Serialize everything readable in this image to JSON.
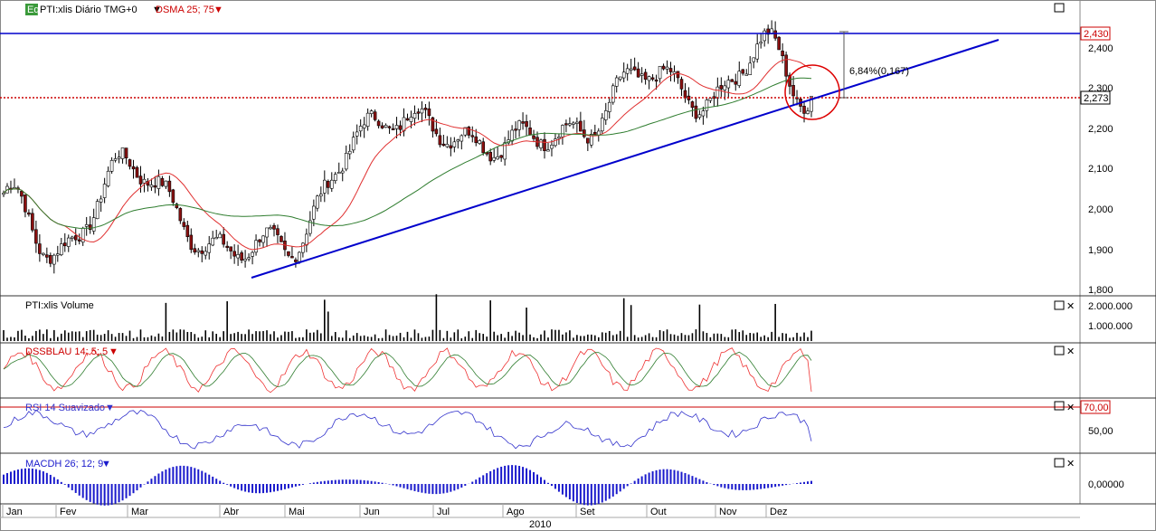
{
  "header": {
    "logo": "Eq",
    "symbol_label": "PTI:xlis Diário TMG+0",
    "indicator_label": "DSMA 25; 75",
    "dropdown_glyph": "▼"
  },
  "price_panel": {
    "y_ticks": [
      "2,400",
      "2,300",
      "2,200",
      "2,100",
      "2,000",
      "1,900",
      "1,800"
    ],
    "resistance_label": "2,430",
    "support_label": "2,273",
    "measure_label": "6,84%(0,167)"
  },
  "volume_panel": {
    "title": "PTI:xlis Volume",
    "y_ticks": [
      "2.000.000",
      "1.000.000"
    ]
  },
  "dss_panel": {
    "title": "DSSBLAU 14; 5; 5"
  },
  "rsi_panel": {
    "title": "RSI 14 Suavizado",
    "level_label": "70,00",
    "y_ticks": [
      "50,00"
    ]
  },
  "macd_panel": {
    "title": "MACDH 26; 12; 9",
    "y_ticks": [
      "0,00000"
    ]
  },
  "x_axis": {
    "months": [
      "Jan",
      "Fev",
      "Mar",
      "Abr",
      "Mai",
      "Jun",
      "Jul",
      "Ago",
      "Set",
      "Out",
      "Nov",
      "Dez"
    ],
    "year": "2010"
  },
  "colors": {
    "resistance": "#0000cc",
    "support": "#cc0000",
    "sma_fast": "#e03030",
    "sma_slow": "#2f7d2f",
    "rsi": "#3333cc",
    "macd": "#1a1acc",
    "circle": "#dd0000"
  },
  "chart_data": {
    "type": "candlestick",
    "title": "PTI:xlis Diário",
    "x_axis_year": "2010",
    "y_range": [
      1.78,
      2.47
    ],
    "anchors": [
      {
        "month": "Jan",
        "close": 2.04
      },
      {
        "month": "Fev",
        "close": 1.85
      },
      {
        "month": "Mar",
        "close": 2.15
      },
      {
        "month": "Abr",
        "close": 1.86
      },
      {
        "month": "Mai",
        "close": 1.93
      },
      {
        "month": "Jun",
        "close": 2.18
      },
      {
        "month": "Jul",
        "close": 2.2
      },
      {
        "month": "Ago",
        "close": 2.19
      },
      {
        "month": "Set",
        "close": 2.15
      },
      {
        "month": "Out",
        "close": 2.38
      },
      {
        "month": "Nov",
        "close": 2.25
      },
      {
        "month": "Dez",
        "close": 2.39
      },
      {
        "month": "Dez (last)",
        "close": 2.28
      }
    ],
    "resistance": 2.43,
    "support_level": 2.273,
    "trendline": {
      "from": {
        "month": "Abr",
        "value": 1.83
      },
      "to": {
        "month": "Dez",
        "value": 2.42
      }
    },
    "volume_max": 2000000,
    "rsi_level": 70
  }
}
